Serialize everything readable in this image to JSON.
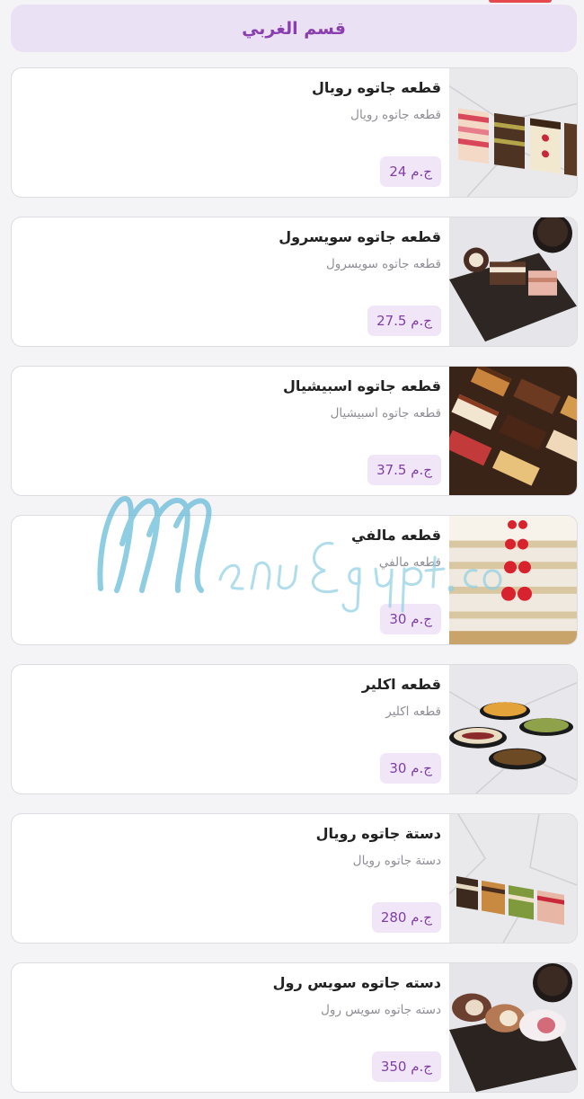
{
  "section": {
    "title": "قسم الغربي"
  },
  "items": [
    {
      "title": "قطعه جاتوه رويال",
      "desc": "قطعه جاتوه رويال",
      "price": "24 ج.م",
      "image": "royal-cake-slices"
    },
    {
      "title": "قطعه جاتوه سويسرول",
      "desc": "قطعه جاتوه سويسرول",
      "price": "27.5 ج.م",
      "image": "swiss-roll-slices"
    },
    {
      "title": "قطعه جاتوه اسبيشيال",
      "desc": "قطعه جاتوه اسبيشيال",
      "price": "37.5 ج.م",
      "image": "special-cake-slices"
    },
    {
      "title": "قطعه مالفي",
      "desc": "قطعه مالفي",
      "price": "30 ج.م",
      "image": "millefeuille-slices"
    },
    {
      "title": "قطعه اكلير",
      "desc": "قطعه اكلير",
      "price": "30 ج.م",
      "image": "eclairs"
    },
    {
      "title": "دستة جاتوه رويال",
      "desc": "دستة جاتوه رويال",
      "price": "280 ج.م",
      "image": "royal-cake-dozen"
    },
    {
      "title": "دسته جاتوه سويس رول",
      "desc": "دسته جاتوه سويس رول",
      "price": "350 ج.م",
      "image": "swiss-roll-dozen"
    }
  ],
  "watermark": {
    "text": "MenuEgypt.com",
    "color": "#5bb6d6"
  }
}
